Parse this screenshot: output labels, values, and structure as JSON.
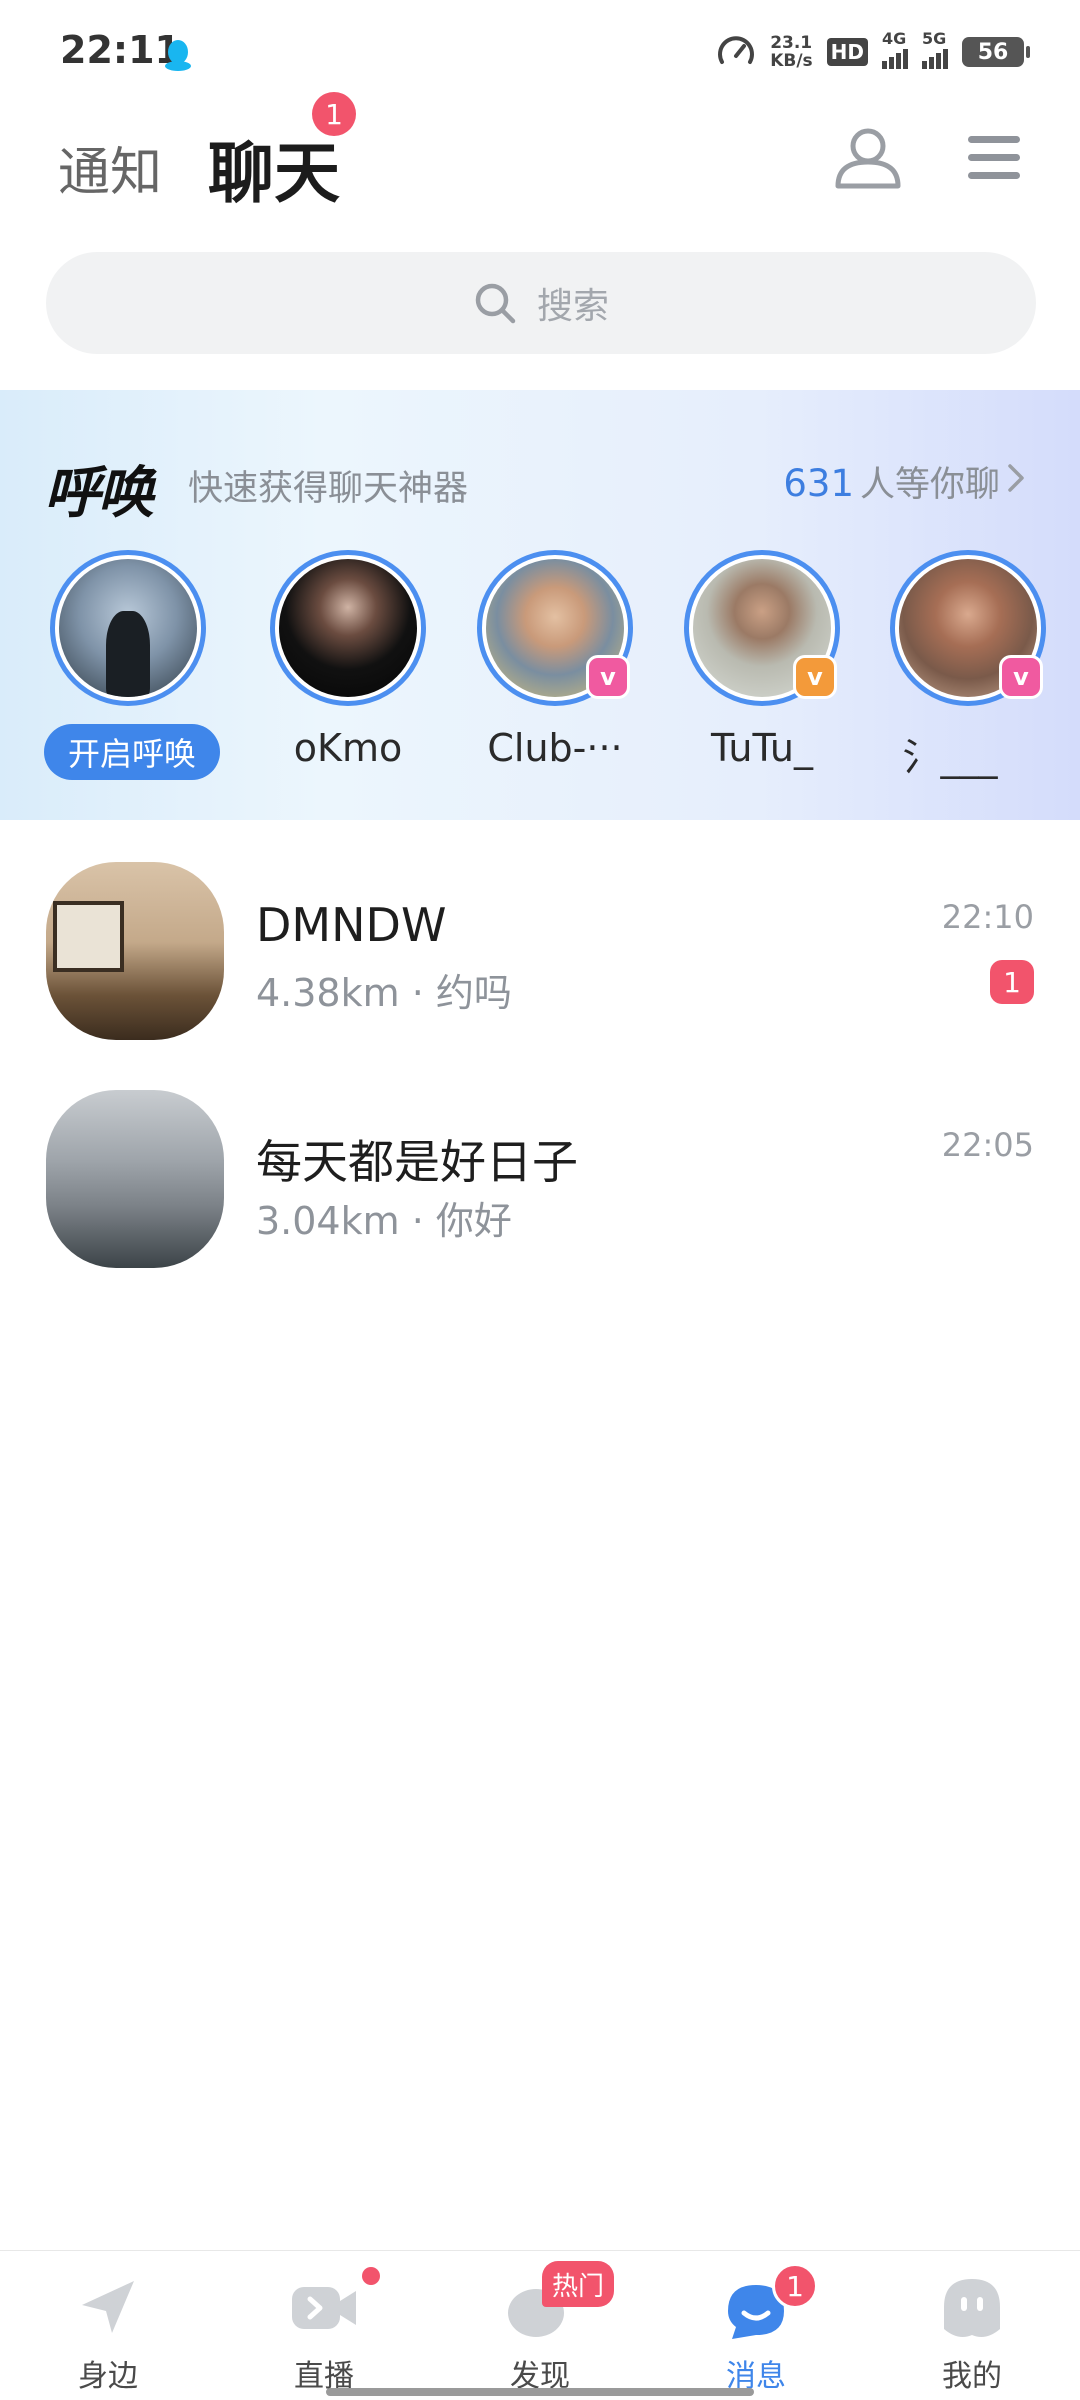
{
  "status_bar": {
    "time": "22:11",
    "net_speed_value": "23.1",
    "net_speed_unit": "KB/s",
    "hd_label": "HD",
    "signal_1_label": "4G",
    "signal_2_label": "5G",
    "battery": "56"
  },
  "header": {
    "tab_notify": "通知",
    "tab_chat": "聊天",
    "tab_chat_badge": "1"
  },
  "search": {
    "placeholder": "搜索"
  },
  "call_banner": {
    "logo": "呼唤",
    "subtitle": "快速获得聊天神器",
    "waiting_count": "631",
    "waiting_text": "人等你聊",
    "start_button": "开启呼唤",
    "callers": [
      {
        "name": "oKmo",
        "badge": ""
      },
      {
        "name": "Club-···",
        "badge": "v",
        "badge_color": "#f05aa0"
      },
      {
        "name": "TuTu_",
        "badge": "v",
        "badge_color": "#f39a3a"
      },
      {
        "name": "氵___",
        "badge": "v",
        "badge_color": "#f05aa0"
      }
    ]
  },
  "chats": [
    {
      "name": "DMNDW",
      "distance": "4.38km",
      "message": "约吗",
      "time": "22:10",
      "unread": "1"
    },
    {
      "name": "每天都是好日子",
      "distance": "3.04km",
      "message": "你好",
      "time": "22:05",
      "unread": ""
    }
  ],
  "bottom_nav": {
    "items": [
      {
        "label": "身边",
        "icon": "nearby-icon"
      },
      {
        "label": "直播",
        "icon": "live-icon"
      },
      {
        "label": "发现",
        "icon": "discover-icon",
        "hot_label": "热门"
      },
      {
        "label": "消息",
        "icon": "message-icon",
        "badge": "1"
      },
      {
        "label": "我的",
        "icon": "profile-icon"
      }
    ]
  },
  "colors": {
    "accent": "#3f86ea",
    "badge": "#f2546c"
  }
}
